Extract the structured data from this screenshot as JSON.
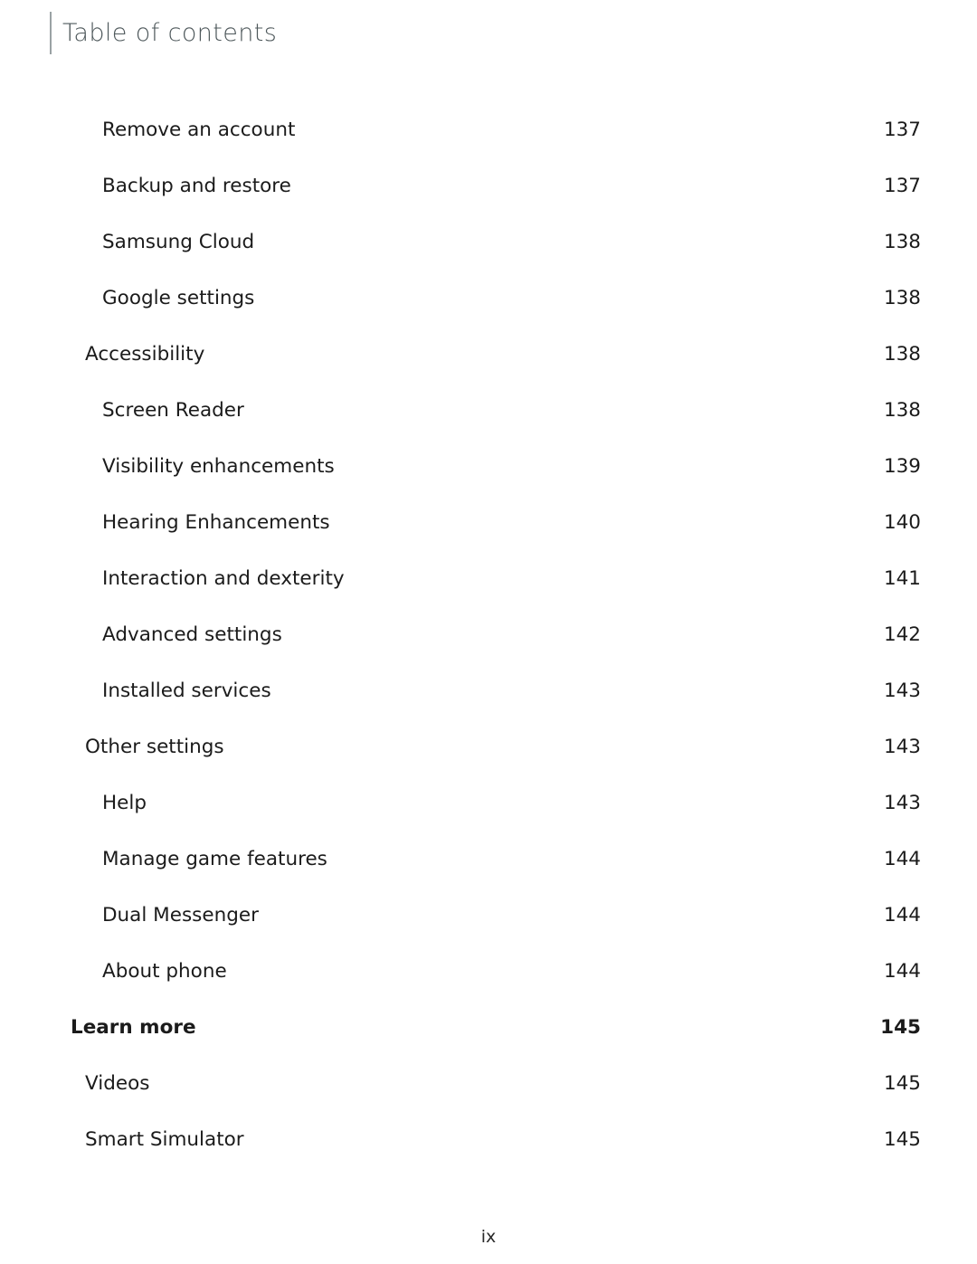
{
  "header": {
    "title": "Table of contents",
    "rule_color": "#9aa2a4",
    "title_color": "#4e585b"
  },
  "footer": {
    "page_number": "ix"
  },
  "toc": {
    "entries": [
      {
        "label": "Remove an account",
        "page": "137",
        "level": 2,
        "bold": false
      },
      {
        "label": "Backup and restore",
        "page": "137",
        "level": 2,
        "bold": false
      },
      {
        "label": "Samsung Cloud",
        "page": "138",
        "level": 2,
        "bold": false
      },
      {
        "label": "Google settings",
        "page": "138",
        "level": 2,
        "bold": false
      },
      {
        "label": "Accessibility",
        "page": "138",
        "level": 1,
        "bold": false
      },
      {
        "label": "Screen Reader",
        "page": "138",
        "level": 2,
        "bold": false
      },
      {
        "label": "Visibility enhancements",
        "page": "139",
        "level": 2,
        "bold": false
      },
      {
        "label": "Hearing Enhancements",
        "page": "140",
        "level": 2,
        "bold": false
      },
      {
        "label": "Interaction and dexterity",
        "page": "141",
        "level": 2,
        "bold": false
      },
      {
        "label": "Advanced settings",
        "page": "142",
        "level": 2,
        "bold": false
      },
      {
        "label": "Installed services",
        "page": "143",
        "level": 2,
        "bold": false
      },
      {
        "label": "Other settings",
        "page": "143",
        "level": 1,
        "bold": false
      },
      {
        "label": "Help",
        "page": "143",
        "level": 2,
        "bold": false
      },
      {
        "label": "Manage game features",
        "page": "144",
        "level": 2,
        "bold": false
      },
      {
        "label": "Dual Messenger",
        "page": "144",
        "level": 2,
        "bold": false
      },
      {
        "label": "About phone",
        "page": "144",
        "level": 2,
        "bold": false
      },
      {
        "label": "Learn more",
        "page": "145",
        "level": 0,
        "bold": true
      },
      {
        "label": "Videos",
        "page": "145",
        "level": 1,
        "bold": false
      },
      {
        "label": "Smart Simulator",
        "page": "145",
        "level": 1,
        "bold": false
      }
    ]
  }
}
